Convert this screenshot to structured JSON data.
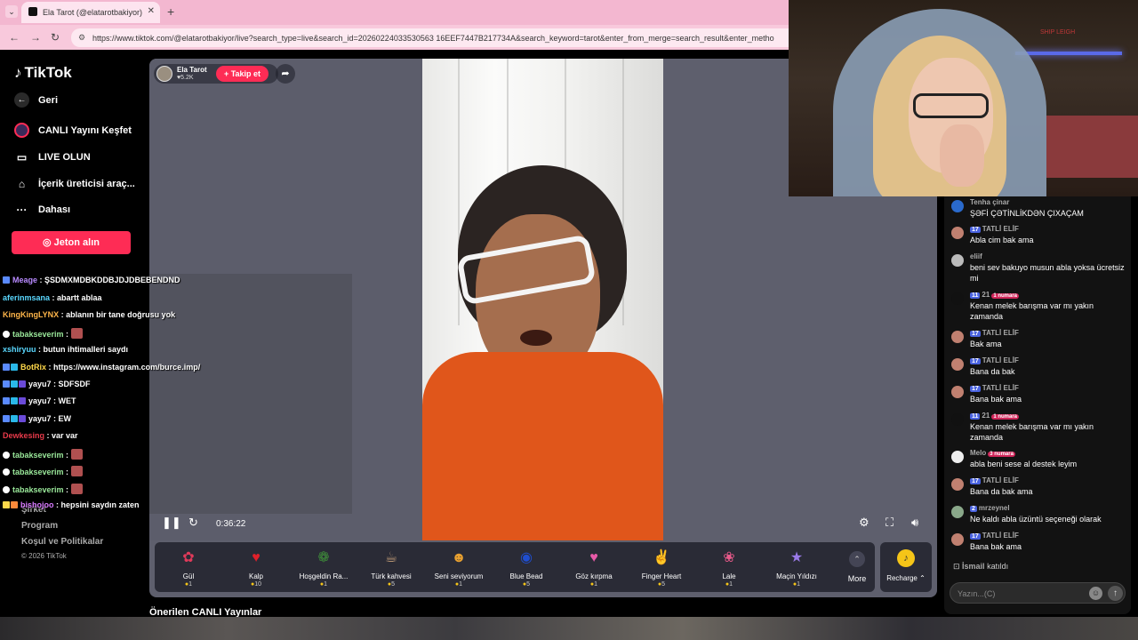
{
  "browser": {
    "tab_title": "Ela Tarot (@elatarotbakiyor)",
    "url": "https://www.tiktok.com/@elatarotbakiyor/live?search_type=live&search_id=20260224033530563 16EEF7447B217734A&search_keyword=tarot&enter_from_merge=search_result&enter_metho"
  },
  "sidebar": {
    "logo": "TikTok",
    "items": [
      {
        "label": "Geri",
        "icon": "back-arrow-icon"
      },
      {
        "label": "CANLI Yayını Keşfet",
        "icon": "live-explore-icon"
      },
      {
        "label": "LIVE OLUN",
        "icon": "camera-icon"
      },
      {
        "label": "İçerik üreticisi araç...",
        "icon": "house-icon"
      },
      {
        "label": "Dahası",
        "icon": "more-dots-icon"
      }
    ],
    "jeton_button": "Jeton alın",
    "footer": {
      "link1": "Şirket",
      "link2": "Program",
      "link3": "Koşul ve Politikalar",
      "copyright": "© 2026 TikTok"
    }
  },
  "stream": {
    "host_name": "Ela Tarot",
    "host_likes": "5.2K",
    "follow_label": "+ Takip et",
    "timer": "0:36:22",
    "recommended_heading": "Önerilen CANLI Yayınlar",
    "more_label": "More",
    "recharge_label": "Recharge",
    "gifts": [
      {
        "name": "Gül",
        "price": "1",
        "icon": "rose-icon",
        "color": "#e03a5a"
      },
      {
        "name": "Kalp",
        "price": "10",
        "icon": "heart-icon",
        "color": "#e0202a"
      },
      {
        "name": "Hoşgeldin Ra...",
        "price": "1",
        "icon": "ramadan-badge-icon",
        "color": "#3f8f3a"
      },
      {
        "name": "Türk kahvesi",
        "price": "5",
        "icon": "coffee-cup-icon",
        "color": "#8a5a32"
      },
      {
        "name": "Seni seviyorum",
        "price": "1",
        "icon": "love-face-icon",
        "color": "#e8a030"
      },
      {
        "name": "Blue Bead",
        "price": "5",
        "icon": "evil-eye-bead-icon",
        "color": "#1f4ed0"
      },
      {
        "name": "Göz kırpma",
        "price": "1",
        "icon": "wink-heart-icon",
        "color": "#e85aa8"
      },
      {
        "name": "Finger Heart",
        "price": "5",
        "icon": "finger-heart-icon",
        "color": "#f09070"
      },
      {
        "name": "Lale",
        "price": "1",
        "icon": "tulip-icon",
        "color": "#e85a8a"
      },
      {
        "name": "Maçin Yıldızı",
        "price": "1",
        "icon": "star-icon",
        "color": "#9a7ae8"
      }
    ]
  },
  "twitch_chat": [
    {
      "user": "Meage",
      "color": "#b88aff",
      "msg": "ŞSDMXMDBKDDBJDJDBEBENDND",
      "emote": false
    },
    {
      "user": "aferinmsana",
      "color": "#5ad8ff",
      "msg": "abartt ablaa",
      "emote": false
    },
    {
      "user": "KingKingLYNX",
      "color": "#ffb64a",
      "msg": "ablanın bir tane doğrusu yok",
      "emote": false
    },
    {
      "user": "tabakseverim",
      "color": "#9ae89a",
      "msg": "",
      "emote": true
    },
    {
      "user": "xshiryuu",
      "color": "#5ad8ff",
      "msg": "butun ihtimalleri saydı",
      "emote": false
    },
    {
      "user": "BotRix",
      "color": "#ffd84a",
      "msg": "https://www.instagram.com/burce.imp/",
      "emote": false
    },
    {
      "user": "yayu7",
      "color": "#fff",
      "msg": "SDFSDF",
      "emote": false
    },
    {
      "user": "yayu7",
      "color": "#fff",
      "msg": "WET",
      "emote": false
    },
    {
      "user": "yayu7",
      "color": "#fff",
      "msg": "EW",
      "emote": false
    },
    {
      "user": "Dewkesing",
      "color": "#e83a4a",
      "msg": "var var",
      "emote": false
    },
    {
      "user": "tabakseverim",
      "color": "#9ae89a",
      "msg": "",
      "emote": true
    },
    {
      "user": "tabakseverim",
      "color": "#9ae89a",
      "msg": "",
      "emote": true
    },
    {
      "user": "tabakseverim",
      "color": "#9ae89a",
      "msg": "",
      "emote": true
    },
    {
      "user": "bishojoo",
      "color": "#d87aff",
      "msg": "hepsini saydın zaten",
      "emote": false
    }
  ],
  "tiktok_chat": [
    {
      "user": "Tenha çinar",
      "level": "",
      "fan": "",
      "text": "ŞƏFİ ÇƏTİNLİKDƏN ÇIXAÇAM",
      "avatar": "#2a6acc"
    },
    {
      "user": "TATLİ ELİF",
      "level": "17",
      "fan": "",
      "text": "Abla cim bak ama",
      "avatar": "#c08070"
    },
    {
      "user": "eliif",
      "level": "",
      "fan": "",
      "text": "beni sev bakuyo musun abla yoksa ücretsiz mi",
      "avatar": "#bbbbbb"
    },
    {
      "user": "21",
      "level": "11",
      "fan": "1 numara",
      "text": "Kenan melek barışma var mı yakın zamanda",
      "avatar": "#111111"
    },
    {
      "user": "TATLİ ELİF",
      "level": "17",
      "fan": "",
      "text": "Bak ama",
      "avatar": "#c08070"
    },
    {
      "user": "TATLİ ELİF",
      "level": "17",
      "fan": "",
      "text": "Bana da bak",
      "avatar": "#c08070"
    },
    {
      "user": "TATLİ ELİF",
      "level": "17",
      "fan": "",
      "text": "Bana bak ama",
      "avatar": "#c08070"
    },
    {
      "user": "21",
      "level": "11",
      "fan": "1 numara",
      "text": "Kenan melek barışma var mı yakın zamanda",
      "avatar": "#111111"
    },
    {
      "user": "Melo",
      "level": "",
      "fan": "3 numara",
      "text": "abla beni sese al destek leyim",
      "avatar": "#eeeeee"
    },
    {
      "user": "TATLİ ELİF",
      "level": "17",
      "fan": "",
      "text": "Bana da bak ama",
      "avatar": "#c08070"
    },
    {
      "user": "mrzeynel",
      "level": "2",
      "fan": "",
      "text": "Ne kaldı abla üzüntü seçeneği olarak",
      "avatar": "#8aa88a"
    },
    {
      "user": "TATLİ ELİF",
      "level": "17",
      "fan": "",
      "text": "Bana bak ama",
      "avatar": "#c08070"
    }
  ],
  "joined": {
    "user": "İsmail",
    "text": "katıldı"
  },
  "chat_input": {
    "placeholder": "Yazın...(C)"
  },
  "webcam": {
    "sign_text": "SHIP LEIGH"
  }
}
